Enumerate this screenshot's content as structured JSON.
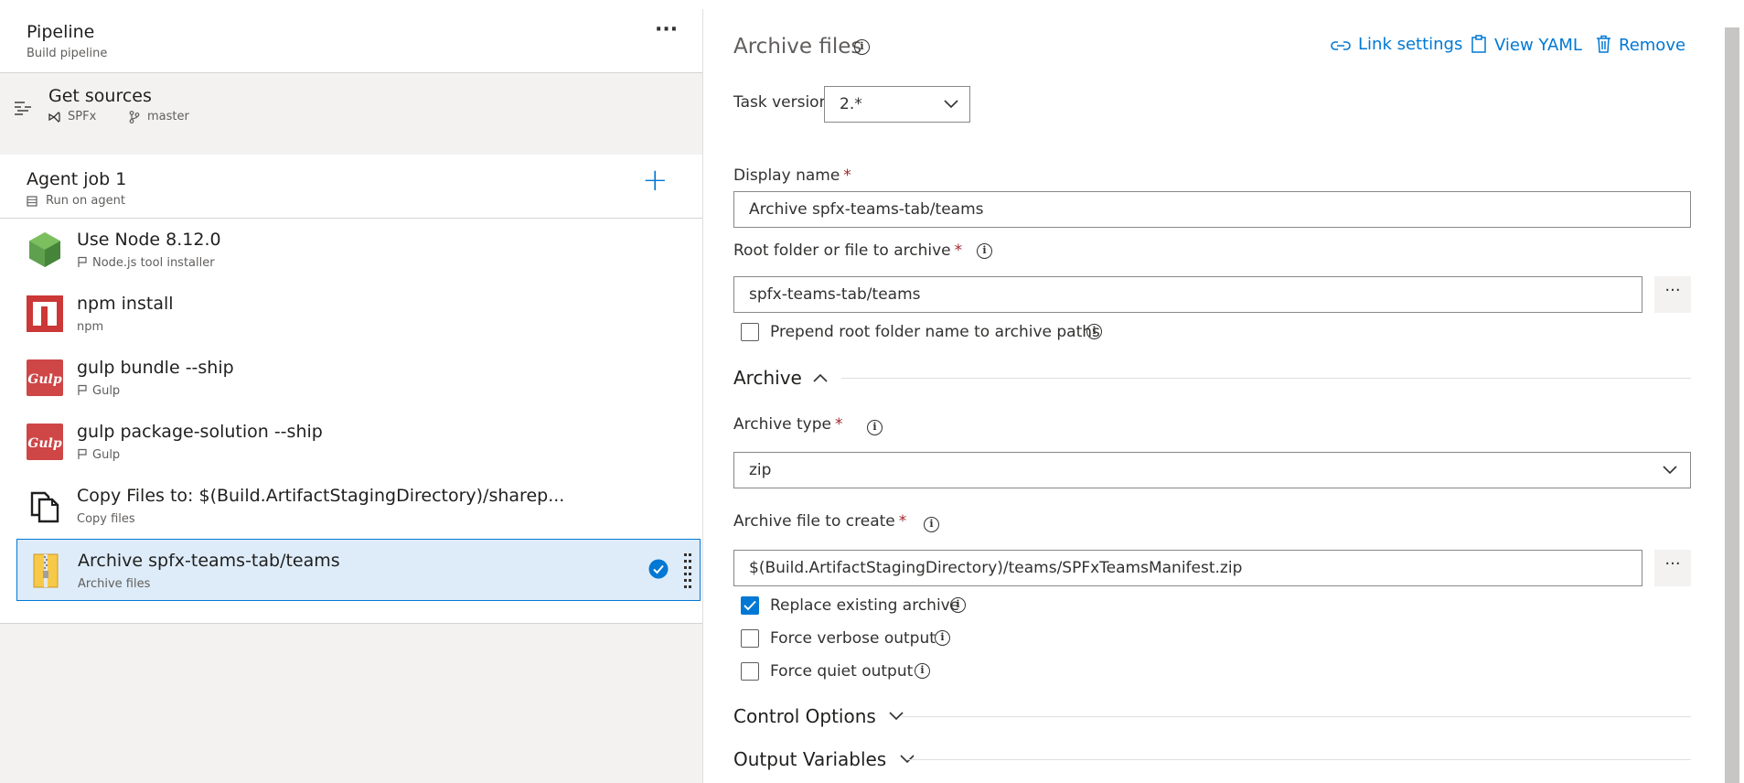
{
  "pipeline": {
    "title": "Pipeline",
    "subtitle": "Build pipeline",
    "more": "···"
  },
  "sources": {
    "title": "Get sources",
    "repo": "SPFx",
    "branch": "master"
  },
  "agent_job": {
    "title": "Agent job 1",
    "subtitle": "Run on agent",
    "add": "+"
  },
  "tasks": [
    {
      "name": "Use Node 8.12.0",
      "sub": "Node.js tool installer",
      "icon": "nodejs-icon"
    },
    {
      "name": "npm install",
      "sub": "npm",
      "icon": "npm-icon"
    },
    {
      "name": "gulp bundle --ship",
      "sub": "Gulp",
      "icon": "gulp-icon"
    },
    {
      "name": "gulp package-solution --ship",
      "sub": "Gulp",
      "icon": "gulp-icon"
    },
    {
      "name": "Copy Files to: $(Build.ArtifactStagingDirectory)/sharep...",
      "sub": "Copy files",
      "icon": "copy-files-icon"
    },
    {
      "name": "Archive spfx-teams-tab/teams",
      "sub": "Archive files",
      "icon": "archive-icon",
      "selected": true
    }
  ],
  "panel": {
    "title": "Archive files",
    "actions": {
      "link_settings": "Link settings",
      "view_yaml": "View YAML",
      "remove": "Remove"
    },
    "task_version": {
      "label": "Task version",
      "value": "2.*"
    },
    "display_name": {
      "label": "Display name",
      "value": "Archive spfx-teams-tab/teams"
    },
    "root_folder": {
      "label": "Root folder or file to archive",
      "value": "spfx-teams-tab/teams"
    },
    "prepend": {
      "label": "Prepend root folder name to archive paths",
      "checked": false
    },
    "archive_section": "Archive",
    "archive_type": {
      "label": "Archive type",
      "value": "zip"
    },
    "archive_file": {
      "label": "Archive file to create",
      "value": "$(Build.ArtifactStagingDirectory)/teams/SPFxTeamsManifest.zip"
    },
    "replace": {
      "label": "Replace existing archive",
      "checked": true
    },
    "verbose": {
      "label": "Force verbose output",
      "checked": false
    },
    "quiet": {
      "label": "Force quiet output",
      "checked": false
    },
    "control_options": "Control Options",
    "output_variables": "Output Variables",
    "required_mark": "*",
    "ellipsis": "···"
  },
  "colors": {
    "accent": "#0078d4",
    "required": "#a4262c",
    "selected_bg": "#deecf9"
  }
}
